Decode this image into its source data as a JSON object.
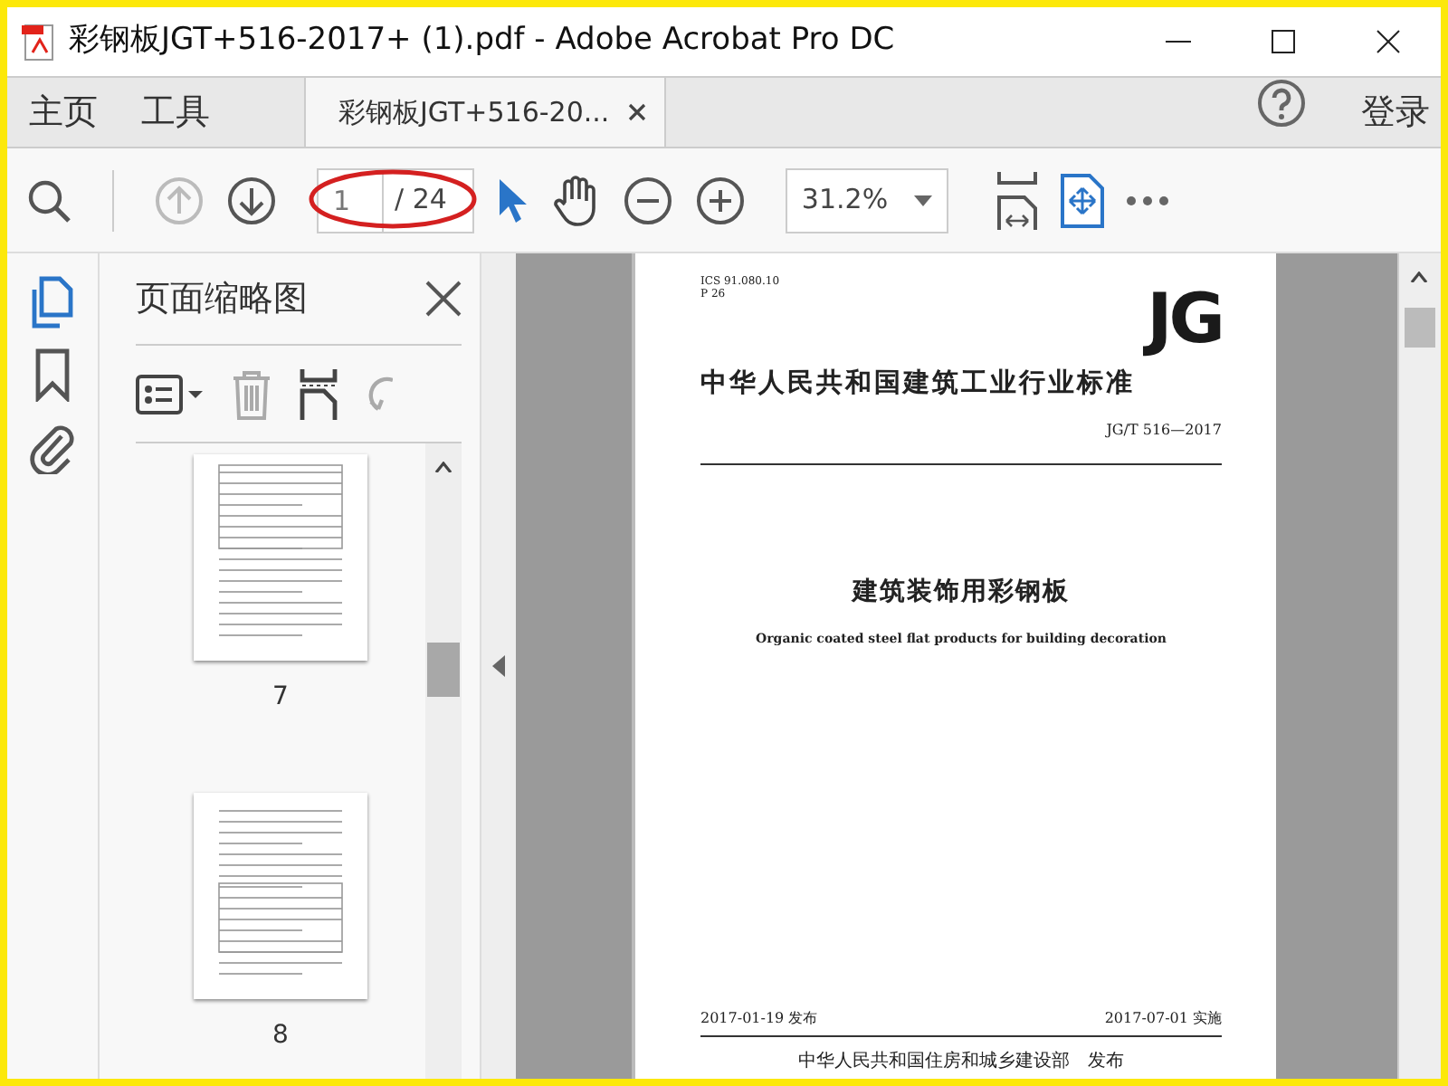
{
  "window": {
    "title": "彩钢板JGT+516-2017+ (1).pdf - Adobe Acrobat Pro DC"
  },
  "nav": [
    {
      "label": "主页"
    },
    {
      "label": "工具"
    }
  ],
  "doc_tab": {
    "label": "彩钢板JGT+516-20...",
    "selected": true
  },
  "sign_in": "登录",
  "toolbar": {
    "page_value": "1",
    "page_total": "/ 24",
    "zoom": "31.2%",
    "prev_disabled": true
  },
  "rail": [
    {
      "kind": "pages",
      "selected": true
    },
    {
      "kind": "bookmark",
      "selected": false
    },
    {
      "kind": "attachment",
      "selected": false
    }
  ],
  "panel": {
    "title": "页面缩略图",
    "thumbnails": [
      {
        "label": "7"
      },
      {
        "label": "8"
      }
    ]
  },
  "page": {
    "codes": [
      "ICS 91.080.10",
      "P 26"
    ],
    "logo": "JG",
    "heading": "中华人民共和国建筑工业行业标准",
    "number": "JG/T 516—2017",
    "title": "建筑装饰用彩钢板",
    "subtitle": "Organic coated steel flat products for building decoration",
    "issued": "2017-01-19 发布",
    "effective": "2017-07-01 实施",
    "issuer": "中华人民共和国住房和城乡建设部　发布"
  }
}
